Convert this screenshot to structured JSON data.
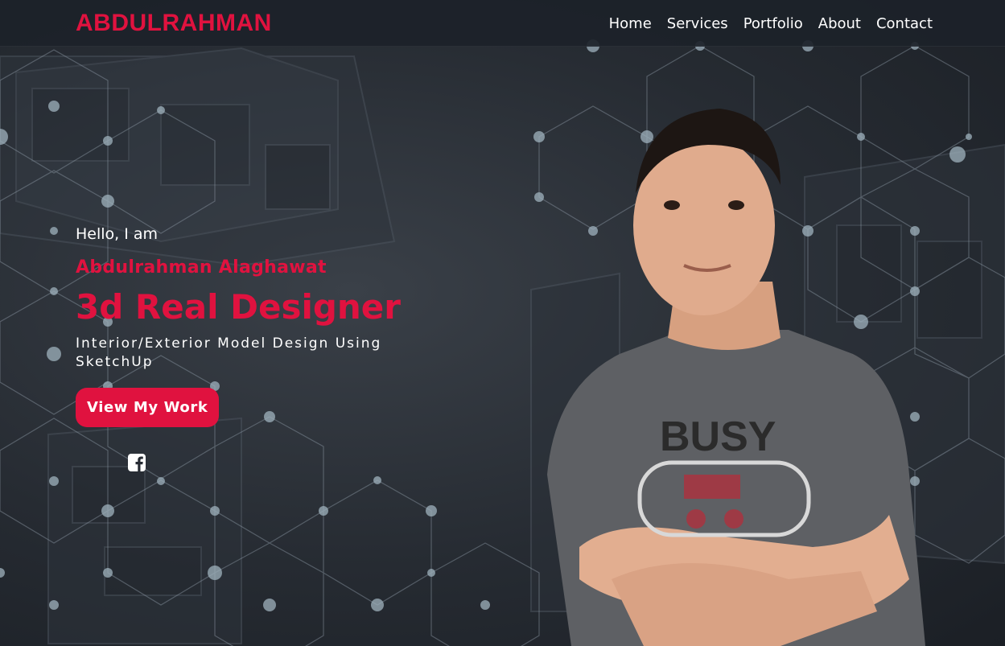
{
  "nav": {
    "brand": "ABDULRAHMAN",
    "links": [
      "Home",
      "Services",
      "Portfolio",
      "About",
      "Contact"
    ]
  },
  "hero": {
    "greeting": "Hello, I am",
    "name": "Abdulrahman Alaghawat",
    "role": "3d Real Designer",
    "tagline": "Interior/Exterior Model Design Using SketchUp",
    "cta_label": "View My Work",
    "social_icons": [
      "facebook-icon"
    ],
    "portrait_shirt_text": "BUSY"
  },
  "colors": {
    "accent": "#e0123f",
    "navbar": "#1c2229",
    "background": "#2a3038",
    "text": "#ffffff"
  }
}
